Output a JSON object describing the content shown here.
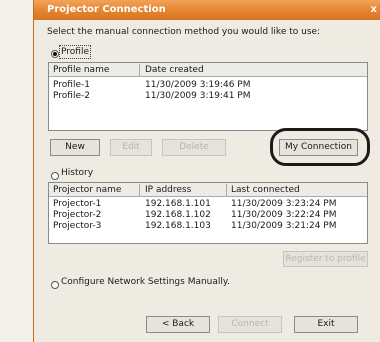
{
  "window": {
    "title": "Projector Connection",
    "close_glyph": "x",
    "instruction": "Select the manual connection method you would like to use:"
  },
  "profile": {
    "option_label": "Profile",
    "columns": [
      "Profile name",
      "Date created"
    ],
    "rows": [
      [
        "Profile-1",
        "11/30/2009 3:19:46 PM"
      ],
      [
        "Profile-2",
        "11/30/2009 3:19:41 PM"
      ]
    ],
    "new_label": "New",
    "edit_label": "Edit",
    "delete_label": "Delete",
    "my_connection_label": "My Connection"
  },
  "history": {
    "option_label": "History",
    "columns": [
      "Projector name",
      "IP address",
      "Last connected"
    ],
    "rows": [
      [
        "Projector-1",
        "192.168.1.101",
        "11/30/2009 3:23:24 PM"
      ],
      [
        "Projector-2",
        "192.168.1.102",
        "11/30/2009 3:22:24 PM"
      ],
      [
        "Projector-3",
        "192.168.1.103",
        "11/30/2009 3:21:24 PM"
      ]
    ],
    "register_label": "Register to profile"
  },
  "manual": {
    "option_label": "Configure Network Settings Manually."
  },
  "footer": {
    "back_label": "< Back",
    "connect_label": "Connect",
    "exit_label": "Exit"
  }
}
